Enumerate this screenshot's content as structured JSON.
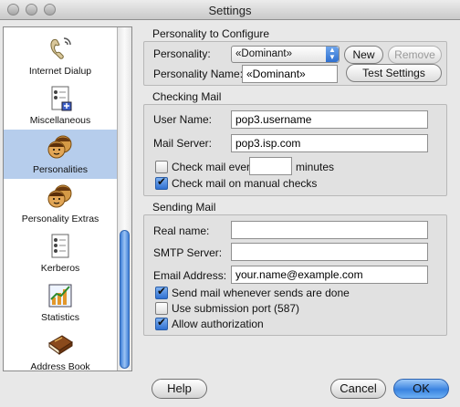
{
  "window": {
    "title": "Settings"
  },
  "sidebar": {
    "items": [
      {
        "label": "Internet Dialup",
        "icon": "dialup-icon"
      },
      {
        "label": "Miscellaneous",
        "icon": "miscellaneous-icon"
      },
      {
        "label": "Personalities",
        "icon": "personalities-icon",
        "selected": true
      },
      {
        "label": "Personality Extras",
        "icon": "personality-extras-icon"
      },
      {
        "label": "Kerberos",
        "icon": "kerberos-icon"
      },
      {
        "label": "Statistics",
        "icon": "statistics-icon"
      },
      {
        "label": "Address Book",
        "icon": "address-book-icon"
      }
    ]
  },
  "personality": {
    "section_title": "Personality to Configure",
    "personality_label": "Personality:",
    "personality_value": "«Dominant»",
    "new_label": "New",
    "remove_label": "Remove",
    "name_label": "Personality Name:",
    "name_value": "«Dominant»",
    "test_label": "Test Settings"
  },
  "checking": {
    "section_title": "Checking Mail",
    "username_label": "User Name:",
    "username_value": "pop3.username",
    "server_label": "Mail Server:",
    "server_value": "pop3.isp.com",
    "check_every_label": "Check mail every",
    "check_every_value": "",
    "minutes_label": "minutes",
    "check_every_checked": false,
    "manual_label": "Check mail on manual checks",
    "manual_checked": true
  },
  "sending": {
    "section_title": "Sending Mail",
    "realname_label": "Real name:",
    "realname_value": "",
    "smtp_label": "SMTP Server:",
    "smtp_value": "",
    "email_label": "Email Address:",
    "email_value": "your.name@example.com",
    "send_when_label": "Send mail whenever sends are done",
    "send_when_checked": true,
    "submission_label": "Use submission port (587)",
    "submission_checked": false,
    "auth_label": "Allow authorization",
    "auth_checked": true
  },
  "buttons": {
    "help": "Help",
    "cancel": "Cancel",
    "ok": "OK"
  },
  "colors": {
    "selection": "#b6cdec",
    "accent": "#3a83e0"
  }
}
